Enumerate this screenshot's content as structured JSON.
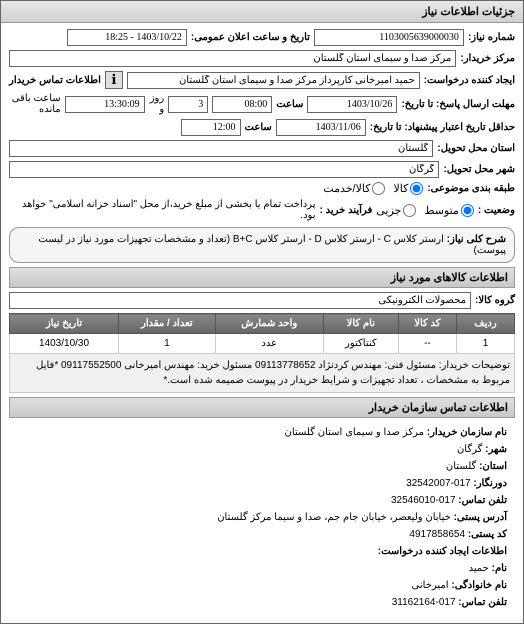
{
  "panel_title": "جزئیات اطلاعات نیاز",
  "fields": {
    "request_no_label": "شماره نیاز:",
    "request_no": "1103005639000030",
    "public_datetime_label": "تاریخ و ساعت اعلان عمومی:",
    "public_datetime": "1403/10/22 - 18:25",
    "buyer_center_label": "مرکز خریدار:",
    "buyer_center": "مرکز صدا و سیمای استان گلستان",
    "requester_label": "ایجاد کننده درخواست:",
    "requester": "حمید امیرخانی کارپرداز مرکز صدا و سیمای استان گلستان",
    "contact_btn": "اطلاعات تماس خریدار",
    "deadline_label": "مهلت ارسال پاسخ: تا تاریخ:",
    "deadline_date": "1403/10/26",
    "deadline_time_label": "ساعت",
    "deadline_time": "08:00",
    "days_remain": "3",
    "days_remain_label": "روز و",
    "hours_remain": "13:30:09",
    "hours_remain_label": "ساعت باقی مانده",
    "validity_label": "حداقل تاریخ اعتبار پیشنهاد: تا تاریخ:",
    "validity_date": "1403/11/06",
    "validity_time_label": "ساعت",
    "validity_time": "12:00",
    "province_label": "استان محل تحویل:",
    "province": "گلستان",
    "city_label": "شهر محل تحویل:",
    "city": "گرگان",
    "category_label": "طبقه بندی موضوعی:",
    "cat_all": "کالا",
    "cat_goods": "کالا/خدمت",
    "situation_label": "وضعیت :",
    "sit_medium": "متوسط",
    "sit_partial": "جزیی",
    "process_label": "فرآیند خرید :",
    "process_note": "پرداخت تمام یا بخشی از مبلغ خرید،از محل \"اسناد خزانه اسلامی\" خواهد بود.",
    "keywords_label": "شرح کلی نیاز:",
    "keywords": "ارستر کلاس C - ارستر کلاس D - ارستر کلاس B+C (تعداد و مشخصات تجهیزات مورد نیاز در لیست پیوست)"
  },
  "goods_section_title": "اطلاعات کالاهای مورد نیاز",
  "goods_group_label": "گروه کالا:",
  "goods_group": "محصولات الکترونیکی",
  "table": {
    "headers": [
      "ردیف",
      "کد کالا",
      "نام کالا",
      "واحد شمارش",
      "تعداد / مقدار",
      "تاریخ نیاز"
    ],
    "rows": [
      {
        "idx": "1",
        "code": "--",
        "name": "کنتاکتور",
        "unit": "عدد",
        "qty": "1",
        "date": "1403/10/30"
      }
    ],
    "notes_label": "توضیحات خریدار:",
    "notes": "مسئول فنی: مهندس کردنژاد 09113778652 مسئول خرید: مهندس امیرخانی 09117552500 *فایل مربوط به مشخصات ، تعداد تجهیزات و شرایط خریدار در پیوست ضمیمه شده است.*"
  },
  "contact_section_title": "اطلاعات تماس سازمان خریدار",
  "contact": {
    "org_label": "نام سازمان خریدار:",
    "org": "مرکز صدا و سیمای استان گلستان",
    "city_label": "شهر:",
    "city": "گرگان",
    "province_label": "استان:",
    "province": "گلستان",
    "fax_label": "دورنگار:",
    "fax": "017-32542007",
    "phone_label": "تلفن تماس:",
    "phone": "017-32546010",
    "address_label": "آدرس پستی:",
    "address": "خیابان ولیعصر، خیابان جام جم، صدا و سیما مرکز گلستان",
    "postal_label": "کد پستی:",
    "postal": "4917858654",
    "requester_info_label": "اطلاعات ایجاد کننده درخواست:",
    "name_label": "نام:",
    "name": "حمید",
    "family_label": "نام خانوادگی:",
    "family": "امیرخانی",
    "tel_label": "تلفن تماس:",
    "tel": "017-31162164"
  }
}
